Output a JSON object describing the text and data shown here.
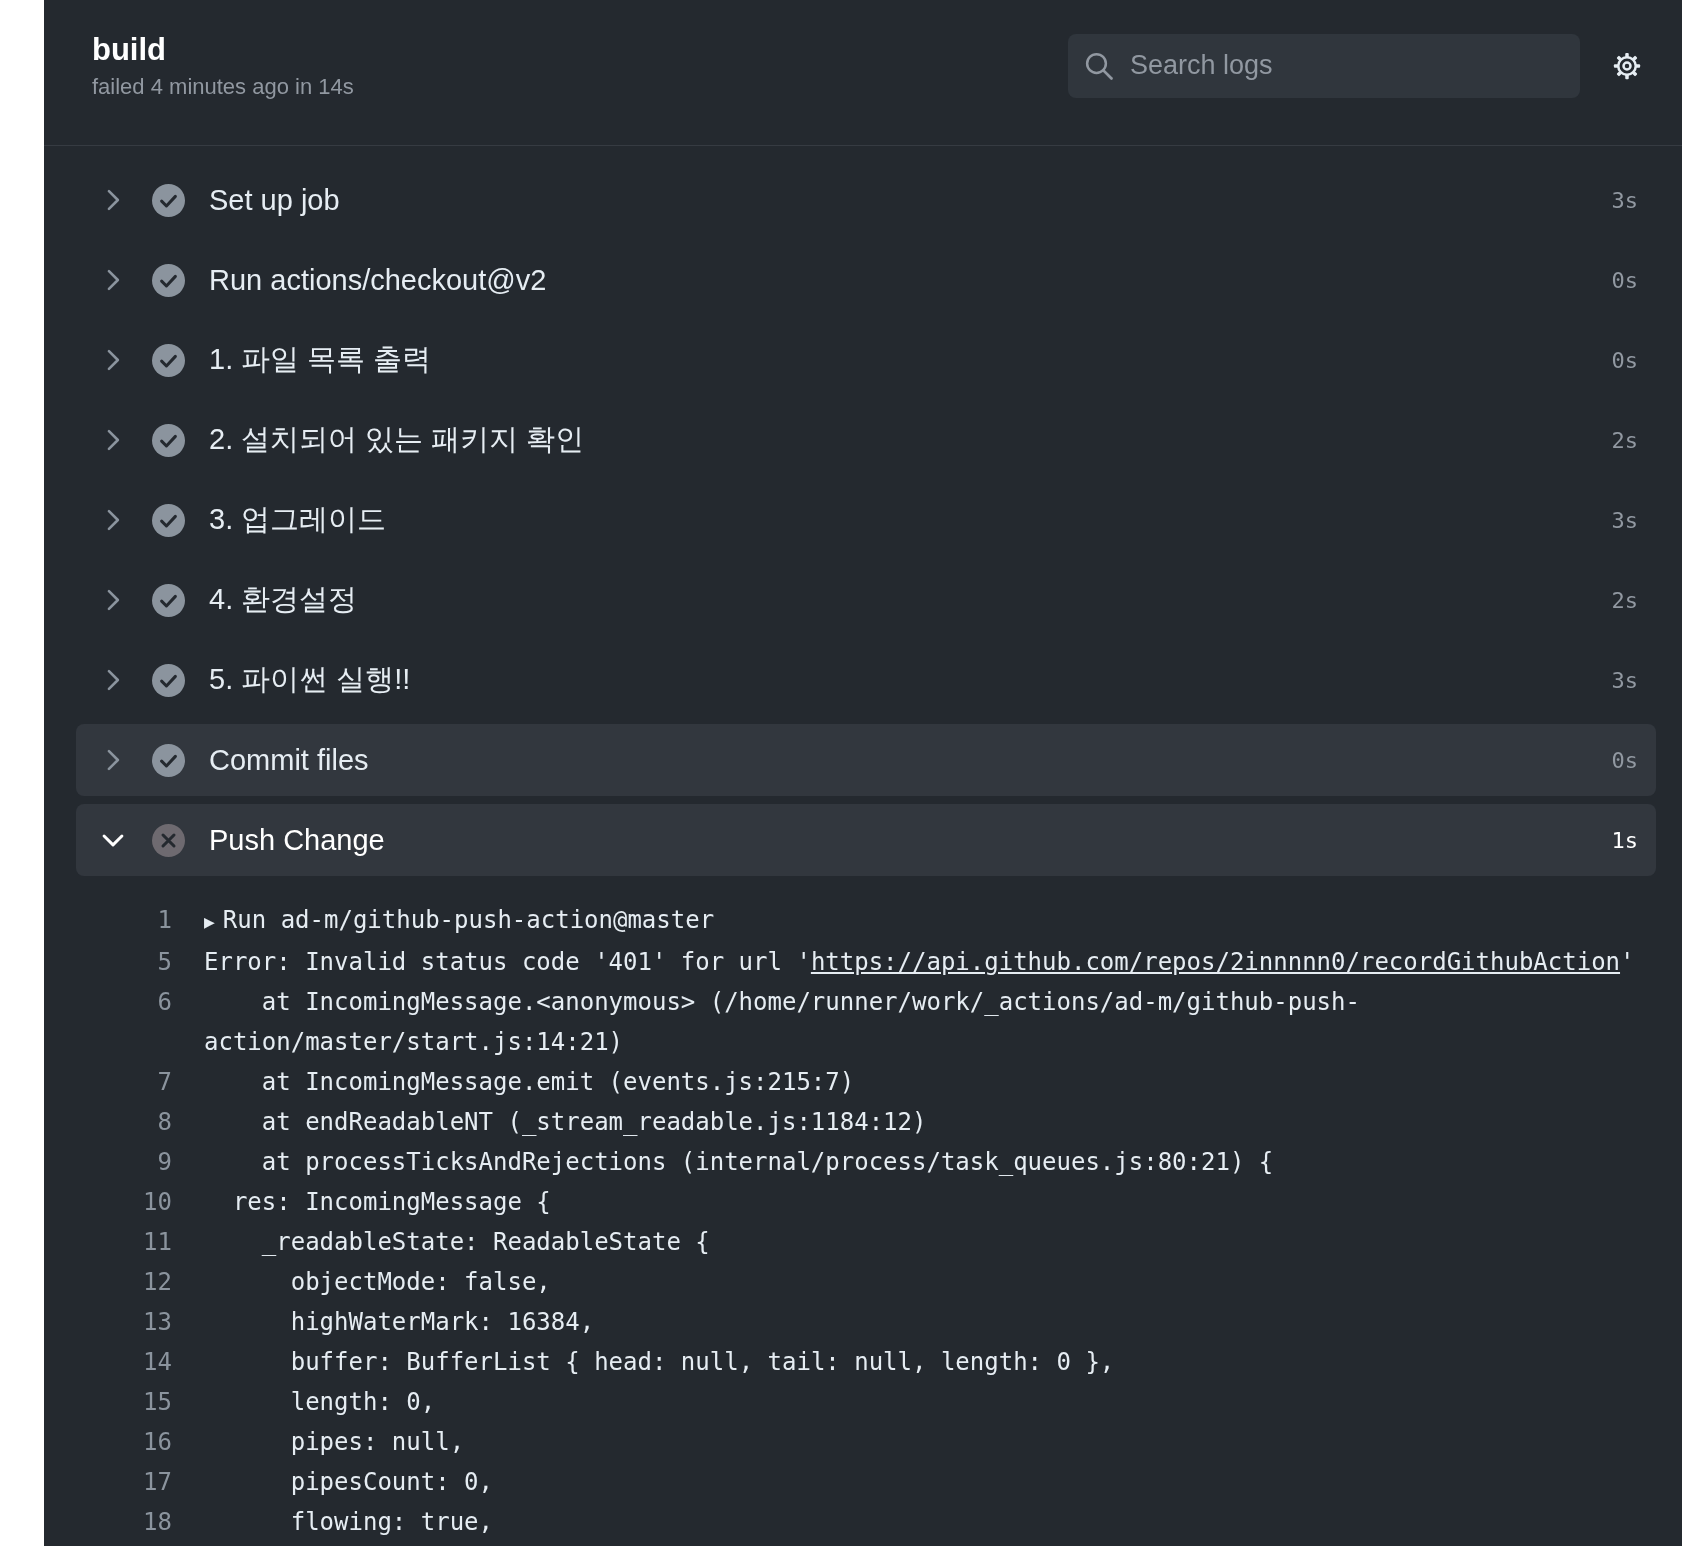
{
  "header": {
    "title": "build",
    "subtitle": "failed 4 minutes ago in 14s"
  },
  "search": {
    "placeholder": "Search logs"
  },
  "steps": [
    {
      "name": "Set up job",
      "duration": "3s",
      "failed": false,
      "expanded": false,
      "hovered": false
    },
    {
      "name": "Run actions/checkout@v2",
      "duration": "0s",
      "failed": false,
      "expanded": false,
      "hovered": false
    },
    {
      "name": "1. 파일 목록 출력",
      "duration": "0s",
      "failed": false,
      "expanded": false,
      "hovered": false
    },
    {
      "name": "2. 설치되어 있는 패키지 확인",
      "duration": "2s",
      "failed": false,
      "expanded": false,
      "hovered": false
    },
    {
      "name": "3. 업그레이드",
      "duration": "3s",
      "failed": false,
      "expanded": false,
      "hovered": false
    },
    {
      "name": "4. 환경설정",
      "duration": "2s",
      "failed": false,
      "expanded": false,
      "hovered": false
    },
    {
      "name": "5. 파이썬 실행!!",
      "duration": "3s",
      "failed": false,
      "expanded": false,
      "hovered": false
    },
    {
      "name": "Commit files",
      "duration": "0s",
      "failed": false,
      "expanded": false,
      "hovered": true
    },
    {
      "name": "Push Change",
      "duration": "1s",
      "failed": true,
      "expanded": true,
      "hovered": false
    }
  ],
  "log": [
    {
      "number": "1",
      "toggle": "▶",
      "text": "Run ad-m/github-push-action@master"
    },
    {
      "number": "5",
      "text": "Error: Invalid status code '401' for url '",
      "link": "https://api.github.com/repos/2innnnn0/recordGithubAction",
      "after": "'"
    },
    {
      "number": "6",
      "text": "    at IncomingMessage.<anonymous> (/home/runner/work/_actions/ad-m/github-push-action/master/start.js:14:21)"
    },
    {
      "number": "7",
      "text": "    at IncomingMessage.emit (events.js:215:7)"
    },
    {
      "number": "8",
      "text": "    at endReadableNT (_stream_readable.js:1184:12)"
    },
    {
      "number": "9",
      "text": "    at processTicksAndRejections (internal/process/task_queues.js:80:21) {"
    },
    {
      "number": "10",
      "text": "  res: IncomingMessage {"
    },
    {
      "number": "11",
      "text": "    _readableState: ReadableState {"
    },
    {
      "number": "12",
      "text": "      objectMode: false,"
    },
    {
      "number": "13",
      "text": "      highWaterMark: 16384,"
    },
    {
      "number": "14",
      "text": "      buffer: BufferList { head: null, tail: null, length: 0 },"
    },
    {
      "number": "15",
      "text": "      length: 0,"
    },
    {
      "number": "16",
      "text": "      pipes: null,"
    },
    {
      "number": "17",
      "text": "      pipesCount: 0,"
    },
    {
      "number": "18",
      "text": "      flowing: true,"
    }
  ]
}
